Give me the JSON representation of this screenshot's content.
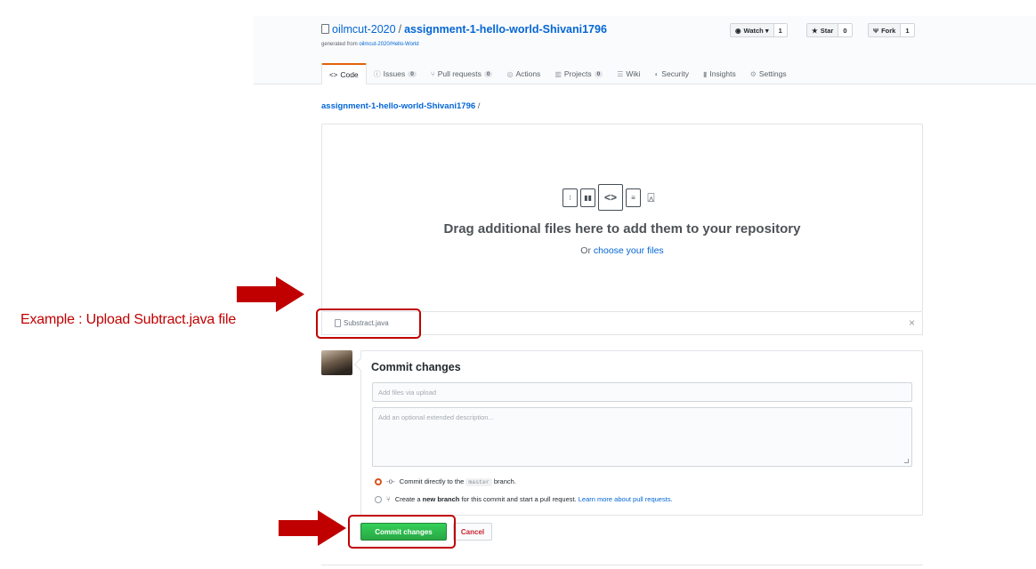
{
  "repo": {
    "owner": "oilmcut-2020",
    "separator": "/",
    "name": "assignment-1-hello-world-Shivani1796",
    "generated_prefix": "generated from ",
    "generated_link": "oilmcut-2020/Hello-World"
  },
  "actions": {
    "watch": {
      "label": "Watch ▾",
      "count": "1"
    },
    "star": {
      "label": "Star",
      "count": "0"
    },
    "fork": {
      "label": "Fork",
      "count": "1"
    }
  },
  "tabs": [
    {
      "label": "Code",
      "icon": "<>"
    },
    {
      "label": "Issues",
      "badge": "0",
      "icon": "ⓘ"
    },
    {
      "label": "Pull requests",
      "badge": "0",
      "icon": "⑂"
    },
    {
      "label": "Actions",
      "icon": "◎"
    },
    {
      "label": "Projects",
      "badge": "0",
      "icon": "▥"
    },
    {
      "label": "Wiki",
      "icon": "☰"
    },
    {
      "label": "Security",
      "icon": "◐"
    },
    {
      "label": "Insights",
      "icon": "▮"
    },
    {
      "label": "Settings",
      "icon": "⚙"
    }
  ],
  "breadcrumb": {
    "repo": "assignment-1-hello-world-Shivani1796",
    "slash": " /"
  },
  "dropzone": {
    "title": "Drag additional files here to add them to your repository",
    "or_text": "Or ",
    "choose_link": "choose your files"
  },
  "uploaded_file": {
    "name": "Substract.java",
    "remove": "×"
  },
  "commit": {
    "title": "Commit changes",
    "summary_placeholder": "Add files via upload",
    "description_placeholder": "Add an optional extended description...",
    "option_direct": {
      "prefix": "Commit directly to the ",
      "branch": "master",
      "suffix": " branch."
    },
    "option_new": {
      "prefix": "Create a ",
      "bold": "new branch",
      "suffix": " for this commit and start a pull request. ",
      "link": "Learn more about pull requests."
    },
    "commit_button": "Commit changes",
    "cancel_button": "Cancel"
  },
  "annotation": {
    "text": "Example  : Upload Subtract.java file",
    "color": "#c00000"
  },
  "colors": {
    "link": "#0366d6",
    "commit_green": "#28a745",
    "cancel_red": "#cb2431",
    "annotation": "#c00000"
  }
}
